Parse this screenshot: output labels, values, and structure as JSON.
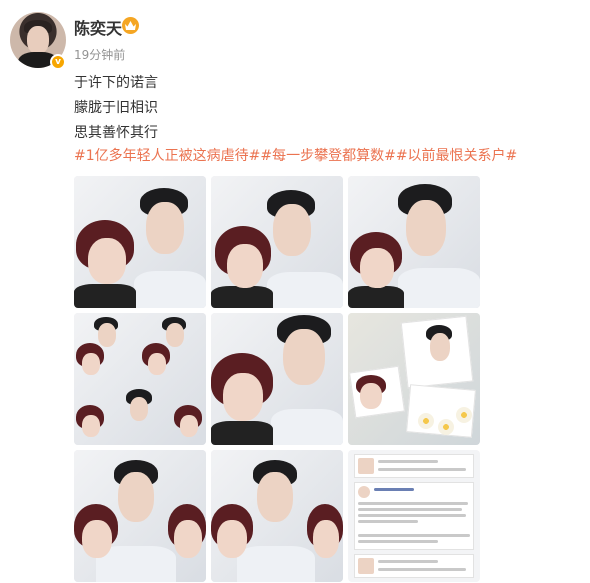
{
  "post": {
    "username": "陈奕天",
    "timestamp": "19分钟前",
    "lines": [
      "于许下的诺言",
      "朦胧于旧相识",
      "思其善怀其行"
    ],
    "hashtags": "#1亿多年轻人正被这病虐待##每一步攀登都算数##以前最恨关系户#",
    "verified_badge": "v",
    "crown_icon": "crown-icon",
    "hashtag_color": "#eb7350"
  },
  "photos": [
    {
      "label": "photo-1"
    },
    {
      "label": "photo-2"
    },
    {
      "label": "photo-3"
    },
    {
      "label": "photo-4"
    },
    {
      "label": "photo-5"
    },
    {
      "label": "photo-6"
    },
    {
      "label": "photo-7"
    },
    {
      "label": "photo-8"
    },
    {
      "label": "photo-9"
    }
  ]
}
